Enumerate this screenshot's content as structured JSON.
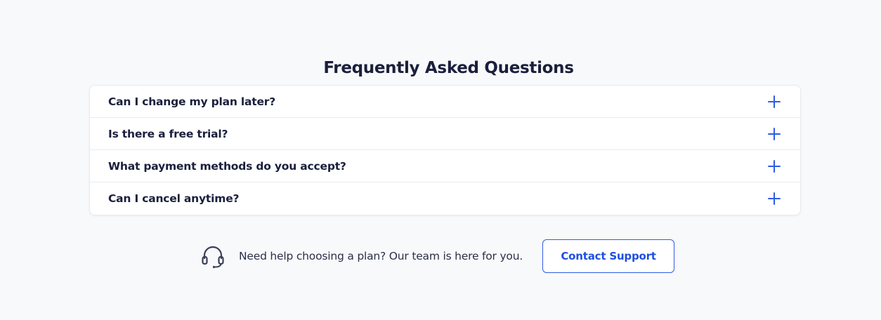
{
  "faq": {
    "title": "Frequently Asked Questions",
    "items": [
      {
        "question": "Can I change my plan later?",
        "icon": "plus-icon"
      },
      {
        "question": "Is there a free trial?",
        "icon": "plus-icon"
      },
      {
        "question": "What payment methods do you accept?",
        "icon": "plus-icon"
      },
      {
        "question": "Can I cancel anytime?",
        "icon": "plus-icon"
      }
    ]
  },
  "support": {
    "icon": "headset-icon",
    "text": "Need help choosing a plan? Our team is here for you.",
    "button_label": "Contact Support"
  },
  "colors": {
    "background": "#f8f9fb",
    "heading": "#1a1f3c",
    "accent": "#1f4fe0",
    "border": "#e8eaef"
  }
}
